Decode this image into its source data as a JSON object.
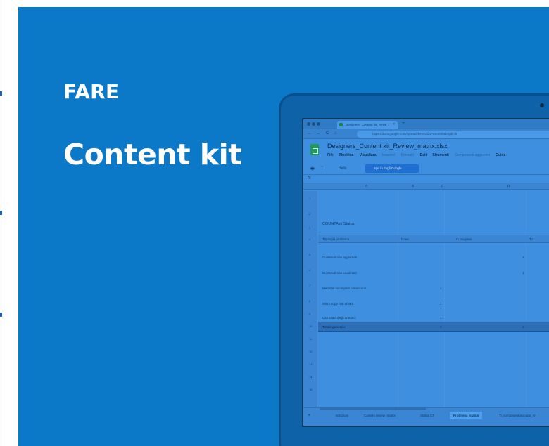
{
  "hero": {
    "eyebrow": "FARE",
    "headline": "Content kit"
  },
  "browser": {
    "tab_title": "Designers_Content kit_Revie...",
    "tab_close": "×",
    "new_tab": "+",
    "nav": {
      "back": "←",
      "forward": "→",
      "reload": "C",
      "home": "⌂"
    },
    "url": "https://docs.google.com/spreadsheets/d/1PmK6n/edit#gid=0"
  },
  "sheet": {
    "doc_title": "Designers_Content kit_Review_matrix.xlsx",
    "menu": [
      {
        "label": "File",
        "dim": false
      },
      {
        "label": "Modifica",
        "dim": false
      },
      {
        "label": "Visualizza",
        "dim": false
      },
      {
        "label": "Inserisci",
        "dim": true
      },
      {
        "label": "Formato",
        "dim": true
      },
      {
        "label": "Dati",
        "dim": false
      },
      {
        "label": "Strumenti",
        "dim": false
      },
      {
        "label": "Componenti aggiuntivi",
        "dim": true
      },
      {
        "label": "Guida",
        "dim": false
      }
    ],
    "toolbar": {
      "print": "🖶",
      "filter": "⊤",
      "font": "Hello",
      "open_button": "Apri in Fogli Google"
    },
    "fx": "fx",
    "columns": [
      "A",
      "B",
      "C",
      "D",
      "E"
    ],
    "rows": [
      "1",
      "2",
      "3",
      "4",
      "5",
      "6",
      "7",
      "8",
      "9",
      "10",
      "11",
      "12",
      "13",
      "14",
      "15",
      "16",
      "17",
      "18"
    ],
    "section_title": "COUNTA di Status",
    "header": [
      "Tipologia problema",
      "Done",
      "In progress",
      "To"
    ],
    "data_rows": [
      {
        "label": "Contenuti non aggiornati",
        "done": "",
        "progress": "",
        "todo": "1"
      },
      {
        "label": "Contenuti non localizzati",
        "done": "",
        "progress": "",
        "todo": "1"
      },
      {
        "label": "Metadati incompleti o mancanti",
        "done": "1",
        "progress": "",
        "todo": ""
      },
      {
        "label": "Micro copy non chiara",
        "done": "1",
        "progress": "",
        "todo": ""
      },
      {
        "label": "Usa scala degli annunci",
        "done": "1",
        "progress": "",
        "todo": ""
      }
    ],
    "total_row": {
      "label": "Totale generale",
      "done": "3",
      "progress": "",
      "todo": "2"
    },
    "tabs": [
      {
        "label": "Istruzioni",
        "active": false
      },
      {
        "label": "Content review_matrix",
        "active": false
      },
      {
        "label": "Status CT",
        "active": false
      },
      {
        "label": "Problema_status",
        "active": true
      },
      {
        "label": "Ti_componentiaccount_re",
        "active": false
      }
    ],
    "add_sheet": "+"
  }
}
